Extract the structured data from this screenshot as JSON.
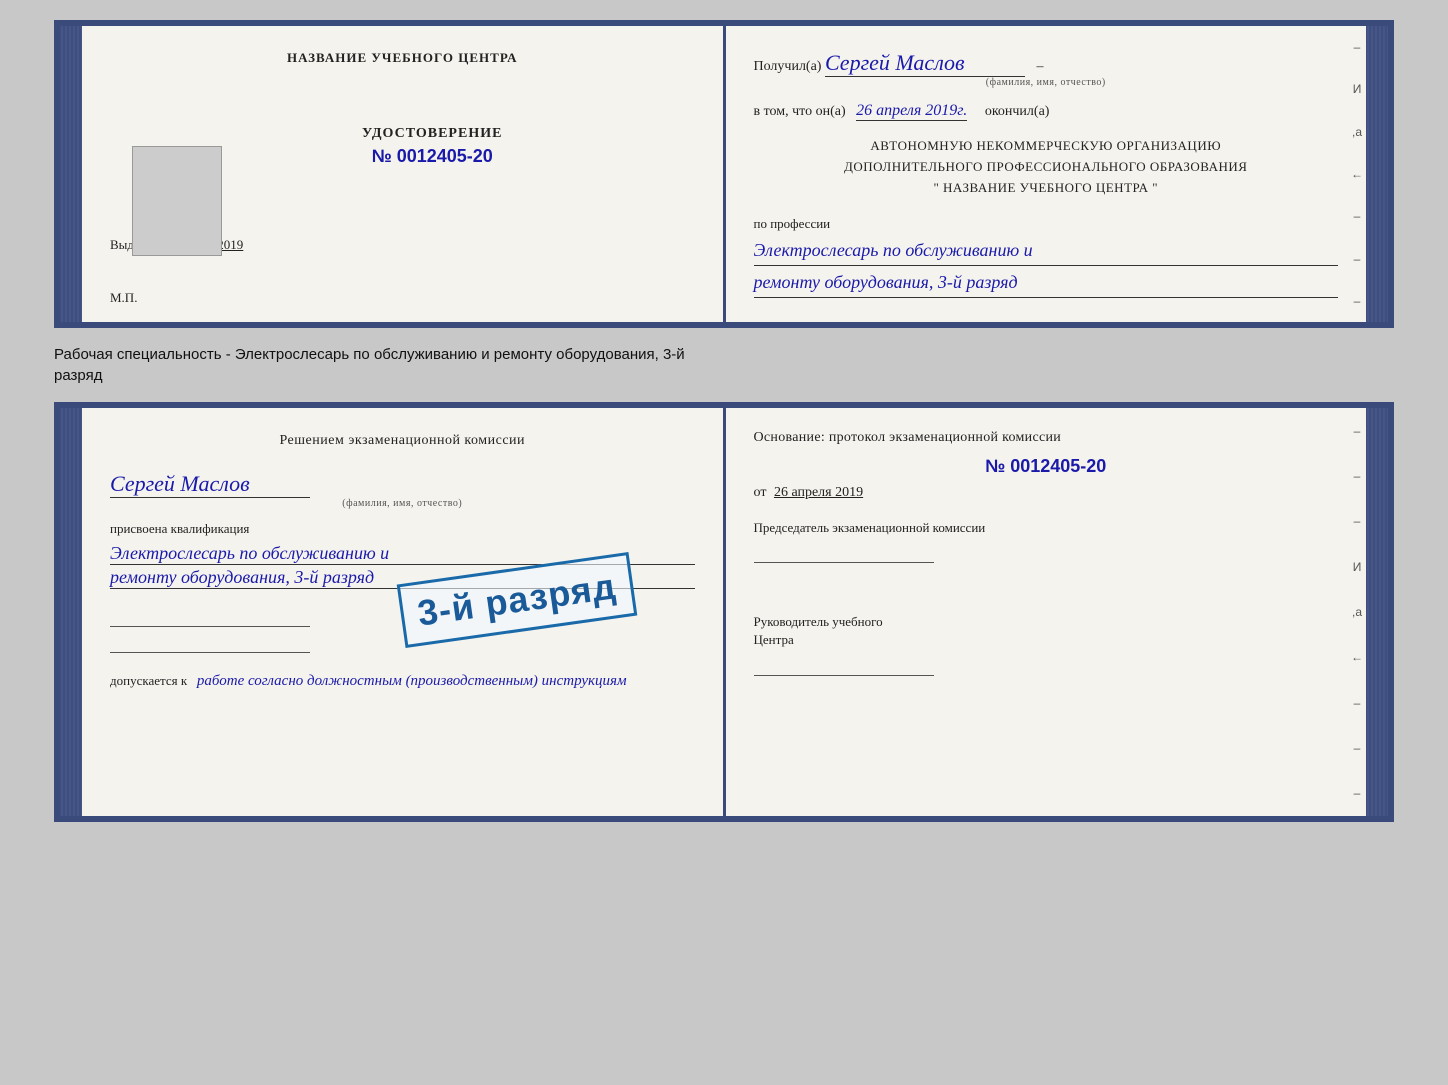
{
  "card1": {
    "left": {
      "header": "НАЗВАНИЕ УЧЕБНОГО ЦЕНТРА",
      "cert_title": "УДОСТОВЕРЕНИЕ",
      "cert_number": "№ 0012405-20",
      "issued_prefix": "Выдано",
      "issued_date": "26 апреля 2019",
      "mp_label": "М.П."
    },
    "right": {
      "received_prefix": "Получил(а)",
      "name": "Сергей Маслов",
      "name_subtitle": "(фамилия, имя, отчество)",
      "dash": "–",
      "line2_prefix": "в том, что он(а)",
      "date_hw": "26 апреля 2019г.",
      "completed": "окончил(а)",
      "org_line1": "АВТОНОМНУЮ НЕКОММЕРЧЕСКУЮ ОРГАНИЗАЦИЮ",
      "org_line2": "ДОПОЛНИТЕЛЬНОГО ПРОФЕССИОНАЛЬНОГО ОБРАЗОВАНИЯ",
      "org_line3": "\"  НАЗВАНИЕ УЧЕБНОГО ЦЕНТРА  \"",
      "profession_label": "по профессии",
      "profession1": "Электрослесарь по обслуживанию и",
      "profession2": "ремонту оборудования, 3-й разряд"
    }
  },
  "caption": {
    "line1": "Рабочая специальность - Электрослесарь по обслуживанию и ремонту оборудования, 3-й",
    "line2": "разряд"
  },
  "card2": {
    "left": {
      "commission_title": "Решением экзаменационной комиссии",
      "name": "Сергей Маслов",
      "name_subtitle": "(фамилия, имя, отчество)",
      "assigned_label": "присвоена квалификация",
      "qual1": "Электрослесарь по обслуживанию и",
      "qual2": "ремонту оборудования, 3-й разряд",
      "allowed_label": "допускается к",
      "allowed_hw": "работе согласно должностным (производственным) инструкциям"
    },
    "right": {
      "basis_label": "Основание: протокол экзаменационной комиссии",
      "basis_number": "№ 0012405-20",
      "basis_date_prefix": "от",
      "basis_date": "26 апреля 2019",
      "commission_head": "Председатель экзаменационной комиссии",
      "study_head_line1": "Руководитель учебного",
      "study_head_line2": "Центра"
    },
    "stamp": {
      "text": "3-й разряд"
    }
  },
  "side_items": [
    "-",
    "И",
    ",а",
    "←",
    "-",
    "-",
    "-"
  ],
  "side_items2": [
    "-",
    "-",
    "-",
    "И",
    ",а",
    "←",
    "-",
    "-",
    "-"
  ]
}
